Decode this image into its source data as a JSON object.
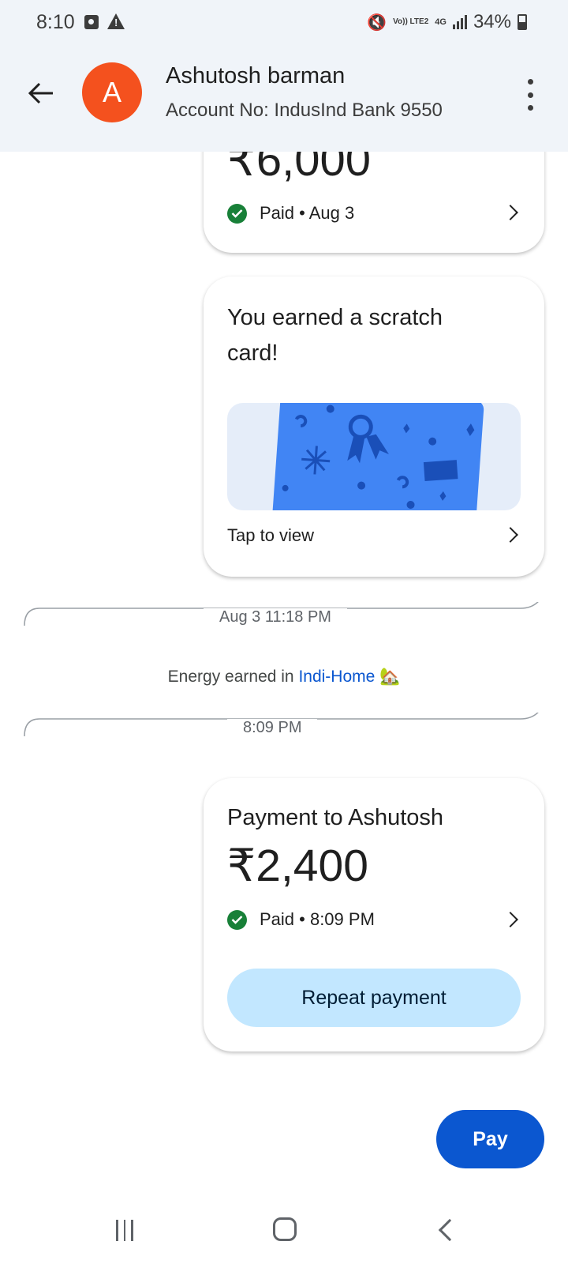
{
  "status_bar": {
    "time": "8:10",
    "volte_label": "Vo)) LTE2",
    "network_label": "4G",
    "battery_percent": "34%",
    "icons": [
      "photo-notification-icon",
      "warning-icon",
      "mute-icon",
      "volte-icon",
      "4g-icon",
      "signal-icon",
      "battery-icon"
    ]
  },
  "header": {
    "avatar_letter": "A",
    "avatar_color": "#f4511e",
    "contact_name": "Ashutosh barman",
    "account_text": "Account No: IndusInd Bank 9550"
  },
  "messages": {
    "payment_card_1": {
      "amount": "₹6,000",
      "status": "Paid • Aug 3"
    },
    "scratch_card": {
      "title": "You earned a scratch card!",
      "action": "Tap to view"
    },
    "divider_1": "Aug 3 11:18 PM",
    "energy": {
      "prefix": "Energy earned in ",
      "link": "Indi-Home",
      "emoji": "🏡"
    },
    "divider_2": "8:09 PM",
    "payment_card_2": {
      "title": "Payment to Ashutosh",
      "amount": "₹2,400",
      "status": "Paid • 8:09 PM",
      "repeat_button": "Repeat payment"
    }
  },
  "actions": {
    "pay_button": "Pay"
  },
  "colors": {
    "header_bg": "#f0f4f9",
    "paid_green": "#188038",
    "pay_blue": "#0b57d0",
    "repeat_bg": "#c2e7ff",
    "scratch_blue": "#4185f4",
    "link_blue": "#0b57d0"
  }
}
